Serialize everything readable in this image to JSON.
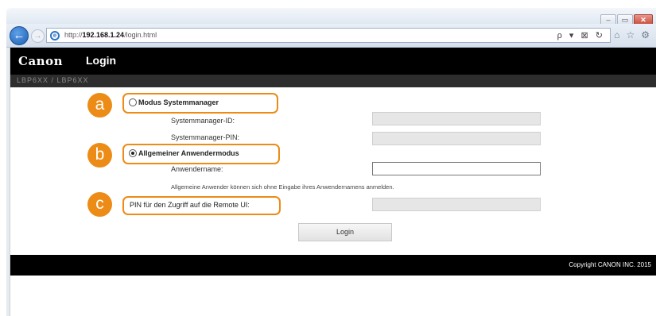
{
  "browser": {
    "url_prefix": "http://",
    "url_host": "192.168.1.24",
    "url_path": "/login.html",
    "address_tools": "ρ ▾ ⊠ ↻",
    "window_controls": {
      "minimize": "–",
      "maximize": "▭",
      "close": "✕"
    },
    "back_glyph": "←",
    "forward_glyph": "→",
    "nav_icons": {
      "home": "⌂",
      "favorites": "☆",
      "settings": "⚙"
    }
  },
  "header": {
    "logo": "Canon",
    "title": "Login",
    "device_name": "LBP6XX / LBP6XX"
  },
  "callouts": {
    "a": "a",
    "b": "b",
    "c": "c"
  },
  "form": {
    "mode_system_manager": "Modus Systemmanager",
    "system_manager_id_label": "Systemmanager-ID:",
    "system_manager_pin_label": "Systemmanager-PIN:",
    "mode_general_user": "Allgemeiner Anwendermodus",
    "username_label": "Anwendername:",
    "hint": "Allgemeine Anwender können sich ohne Eingabe ihres Anwendernamens anmelden.",
    "remote_ui_pin_label": "PIN für den Zugriff auf die Remote UI:",
    "login_button": "Login",
    "selected_mode": "general_user"
  },
  "footer": {
    "copyright": "Copyright CANON INC. 2015"
  },
  "colors": {
    "callout_orange": "#ed8b17",
    "header_black": "#000000"
  }
}
